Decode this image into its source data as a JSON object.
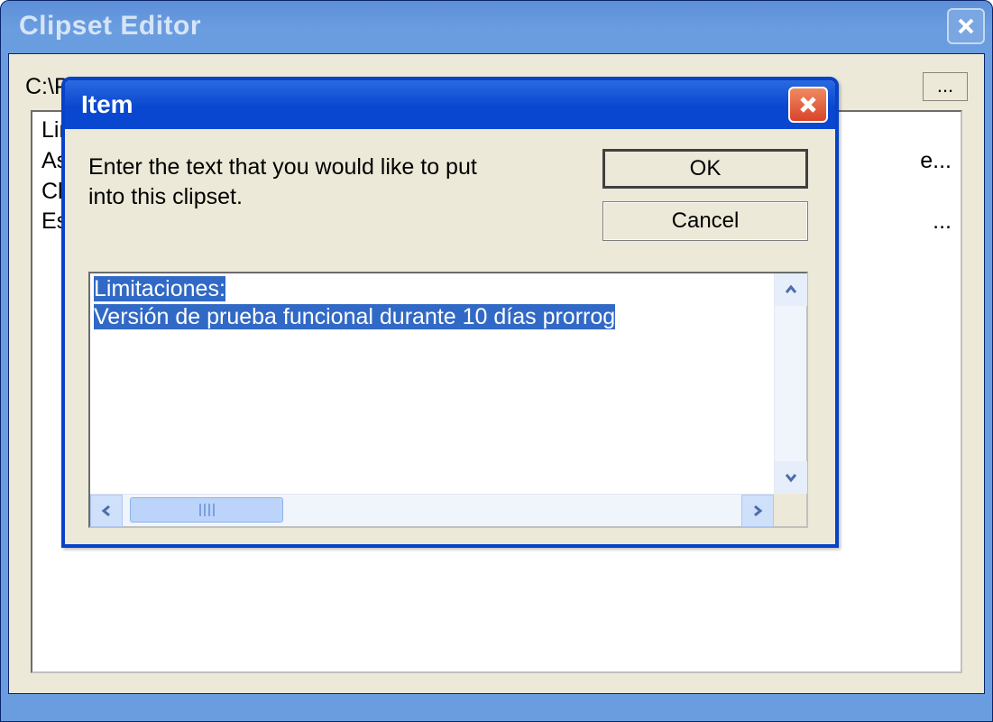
{
  "outer": {
    "title": "Clipset Editor",
    "path_visible": "C:\\Pr",
    "browse_label": "...",
    "list_items": [
      "Limit",
      "Asha",
      "Clipo",
      "  Est"
    ],
    "row_suffixes": [
      "",
      "e...",
      "",
      "..."
    ]
  },
  "dialog": {
    "title": "Item",
    "prompt": "Enter the text that you would like to put into this clipset.",
    "ok_label": "OK",
    "cancel_label": "Cancel",
    "text_line1": "Limitaciones:",
    "text_line2": "Versión de prueba funcional durante 10 días prorrog"
  }
}
